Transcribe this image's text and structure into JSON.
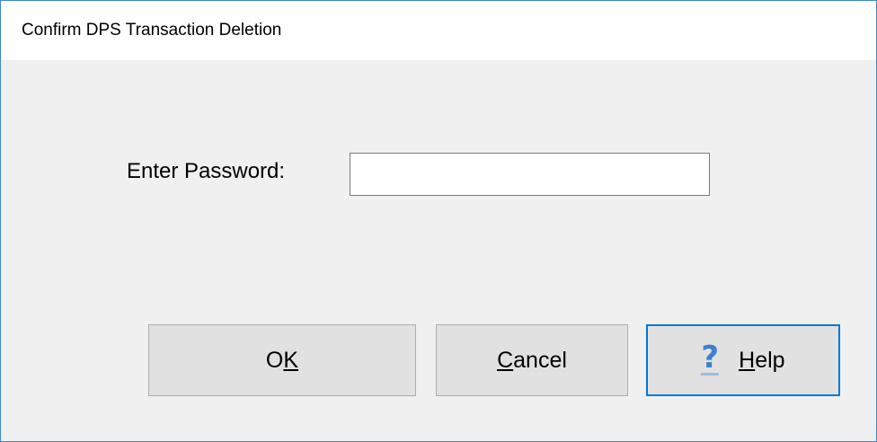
{
  "window": {
    "title": "Confirm DPS Transaction Deletion"
  },
  "form": {
    "password_label": "Enter Password:",
    "password_value": "",
    "password_placeholder": ""
  },
  "buttons": {
    "ok": {
      "accel": "K",
      "prefix": "O",
      "suffix": ""
    },
    "cancel": {
      "accel": "C",
      "prefix": "",
      "suffix": "ancel"
    },
    "help": {
      "accel": "H",
      "prefix": "",
      "suffix": "elp",
      "icon": "help-question-icon",
      "icon_glyph": "?"
    }
  },
  "colors": {
    "accent": "#0078d7",
    "dialog_bg": "#f0f0f0",
    "button_bg": "#e1e1e1",
    "help_icon": "#3d7fd0"
  }
}
